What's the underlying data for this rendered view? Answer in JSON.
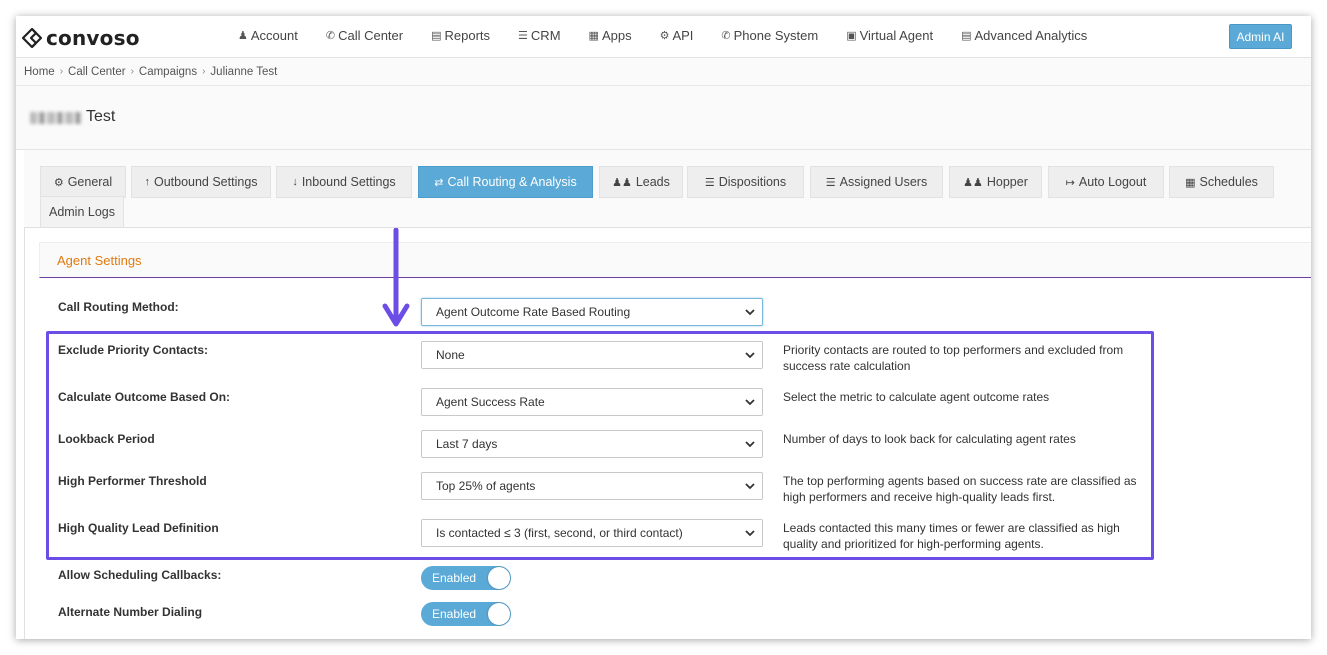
{
  "brand": {
    "name": "convoso"
  },
  "nav": {
    "items": [
      {
        "icon": "user-icon",
        "label": "Account"
      },
      {
        "icon": "phone-icon",
        "label": "Call Center"
      },
      {
        "icon": "bar-chart-icon",
        "label": "Reports"
      },
      {
        "icon": "list-icon",
        "label": "CRM"
      },
      {
        "icon": "grid-icon",
        "label": "Apps"
      },
      {
        "icon": "gear-icon",
        "label": "API"
      },
      {
        "icon": "phone-icon",
        "label": "Phone System"
      },
      {
        "icon": "monitor-icon",
        "label": "Virtual Agent"
      },
      {
        "icon": "bar-chart-icon",
        "label": "Advanced Analytics"
      }
    ],
    "admin_button": "Admin AI"
  },
  "breadcrumb": [
    "Home",
    "Call Center",
    "Campaigns",
    "Julianne Test"
  ],
  "page": {
    "title": "Test"
  },
  "tabs": [
    {
      "icon": "gears-icon",
      "label": "General"
    },
    {
      "icon": "arrow-up-icon",
      "label": "Outbound Settings"
    },
    {
      "icon": "arrow-down-icon",
      "label": "Inbound Settings"
    },
    {
      "icon": "shuffle-icon",
      "label": "Call Routing & Analysis",
      "active": true
    },
    {
      "icon": "users-icon",
      "label": "Leads"
    },
    {
      "icon": "list-icon",
      "label": "Dispositions"
    },
    {
      "icon": "list-ol-icon",
      "label": "Assigned Users"
    },
    {
      "icon": "users-icon",
      "label": "Hopper"
    },
    {
      "icon": "logout-icon",
      "label": "Auto Logout"
    },
    {
      "icon": "calendar-icon",
      "label": "Schedules"
    },
    {
      "icon": "",
      "label": "Admin Logs"
    }
  ],
  "section": {
    "title": "Agent Settings"
  },
  "fields": {
    "routing_method": {
      "label": "Call Routing Method:",
      "value": "Agent Outcome Rate Based Routing"
    },
    "exclude_priority": {
      "label": "Exclude Priority Contacts:",
      "value": "None",
      "help": "Priority contacts are routed to top performers and excluded from success rate calculation"
    },
    "calculate_outcome": {
      "label": "Calculate Outcome Based On:",
      "value": "Agent Success Rate",
      "help": "Select the metric to calculate agent outcome rates"
    },
    "lookback": {
      "label": "Lookback Period",
      "value": "Last 7 days",
      "help": "Number of days to look back for calculating agent rates"
    },
    "high_performer": {
      "label": "High Performer Threshold",
      "value": "Top 25% of agents",
      "help": "The top performing agents based on success rate are classified as high performers and receive high-quality leads first."
    },
    "high_quality_lead": {
      "label": "High Quality Lead Definition",
      "value": "Is contacted ≤ 3 (first, second, or third contact)",
      "help": "Leads contacted this many times or fewer are classified as high quality and prioritized for high-performing agents."
    },
    "allow_callbacks": {
      "label": "Allow Scheduling Callbacks:",
      "value": "Enabled"
    },
    "alternate_dialing": {
      "label": "Alternate Number Dialing",
      "value": "Enabled"
    }
  },
  "colors": {
    "accent": "#5aa9d6",
    "highlight": "#6c4de6",
    "section_title": "#e07a10"
  }
}
